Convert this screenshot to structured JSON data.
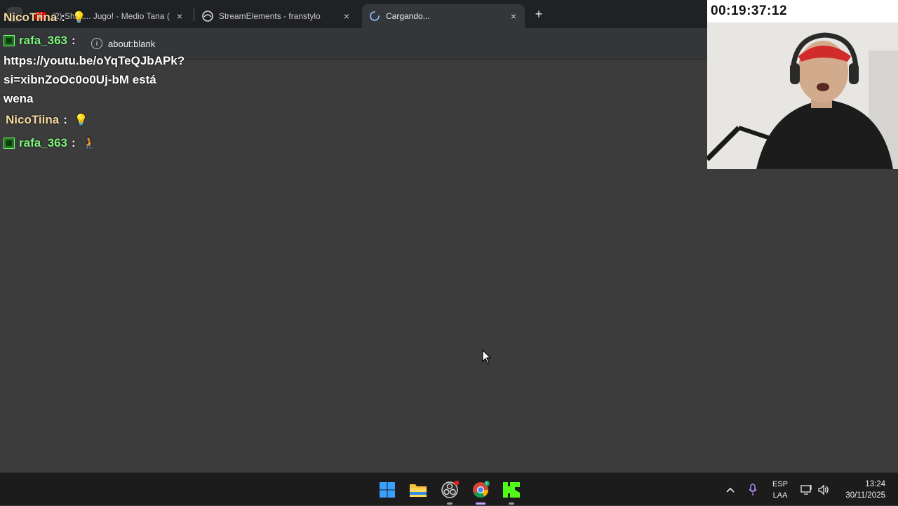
{
  "browser": {
    "tabs": [
      {
        "title": "(2) Shak... Jugo! - Medio Tana (",
        "active": false
      },
      {
        "title": "StreamElements - franstylo",
        "active": false
      },
      {
        "title": "Cargando...",
        "active": true
      }
    ],
    "close_glyph": "×",
    "new_tab_glyph": "+",
    "url": "about:blank"
  },
  "chat": {
    "messages": [
      {
        "user": "NicoTiina",
        "separator": ":",
        "emoji": "💡"
      },
      {
        "user": "rafa_363",
        "separator": ":"
      },
      {
        "text_lines": [
          "https://youtu.be/oYqTeQJbAPk?",
          "si=xibnZoOc0o0Uj-bM está",
          "wena"
        ]
      },
      {
        "user": "NicoTiina",
        "separator": ":",
        "emoji": "💡"
      },
      {
        "user": "rafa_363",
        "separator": ":",
        "emoji": "🧎"
      }
    ]
  },
  "webcam": {
    "timer": "00:19:37:12"
  },
  "taskbar": {
    "icons": [
      "windows-start-icon",
      "file-explorer-icon",
      "obs-icon",
      "chrome-icon",
      "kick-icon"
    ],
    "tray": {
      "chevron": "^",
      "lang_top": "ESP",
      "lang_bottom": "LAA",
      "time": "13:24",
      "date": "30/11/2025"
    }
  },
  "colors": {
    "page_bg": "#3c3c3c",
    "tabstrip_bg": "#202124",
    "toolbar_bg": "#35363a",
    "nico_color": "#f4d9a0",
    "rafa_color": "#7cf57c",
    "kick_green": "#53fc18"
  }
}
